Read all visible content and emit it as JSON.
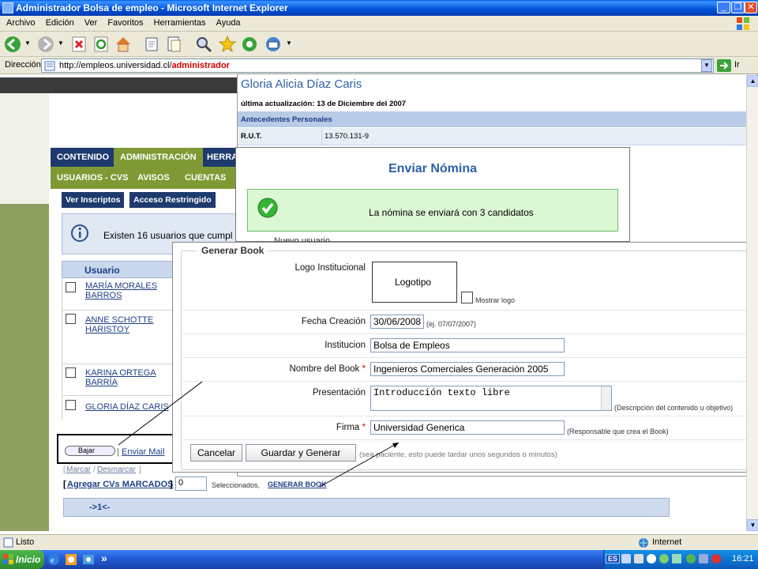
{
  "window": {
    "title": "Administrador Bolsa de empleo - Microsoft Internet Explorer"
  },
  "menu": [
    "Archivo",
    "Edición",
    "Ver",
    "Favoritos",
    "Herramientas",
    "Ayuda"
  ],
  "address": {
    "label": "Dirección",
    "url_prefix": "http://empleos.universidad.cl/",
    "url_highlight": "administrador",
    "go": "Ir"
  },
  "site": {
    "nav_main": [
      "CONTENIDO",
      "ADMINISTRACIÓN",
      "HERRA"
    ],
    "nav_sub": [
      "USUARIOS - CVS",
      "AVISOS",
      "CUENTAS"
    ],
    "buttons": [
      "Ver Inscriptos",
      "Acceso Restringido"
    ],
    "info_text": "Existen 16 usuarios que cumpl",
    "grid_header": "Usuario",
    "users": [
      "MARÍA MORALES BARROS",
      "ANNE SCHOTTE HARISTOY",
      "KARINA ORTEGA BARRÍA",
      "GLORIA DÍAZ CARIS"
    ],
    "action_bajar": "Bajar",
    "action_enviar": "Enviar Mail",
    "marcar": "Marcar",
    "desmarcar": "Desmarcar",
    "agregar": "Agregar CVs MARCADOS",
    "count_value": "0",
    "seleccionados": "Seleccionados,",
    "generar_book": "GENERAR BOOK",
    "pager": "->1<-"
  },
  "profile": {
    "name": "Gloria Alicia Díaz Caris",
    "updated": "última actualización: 13 de Diciembre del 2007",
    "section": "Antecedentes Personales",
    "rut_label": "R.U.T.",
    "rut_value": "13.570.131-9"
  },
  "nomina": {
    "title": "Enviar Nómina",
    "message": "La nómina se enviará con 3 candidatos",
    "partial": "Nuevo usuario"
  },
  "book": {
    "legend": "Generar Book",
    "logo_label": "Logo Institucional",
    "logo_placeholder": "Logotipo",
    "mostrar_logo": "Mostrar logo",
    "fecha_label": "Fecha Creación",
    "fecha_value": "30/06/2008",
    "fecha_hint": "(ej. 07/07/2007)",
    "institucion_label": "Institucion",
    "institucion_value": "Bolsa de Empleos",
    "nombre_label": "Nombre del Book",
    "nombre_value": "Ingenieros Comerciales Generación 2005",
    "presentacion_label": "Presentación",
    "presentacion_value": "Introducción texto libre",
    "presentacion_hint": "(Descripción del contenido u objetivo)",
    "firma_label": "Firma",
    "firma_value": "Universidad Generica",
    "firma_hint": "(Responsable que crea el Book)",
    "required": "*",
    "cancel": "Cancelar",
    "submit": "Guardar y Generar",
    "wait_hint": "(sea paciente, esto puede tardar unos segundos o minutos)"
  },
  "status": {
    "left": "Listo",
    "zone": "Internet"
  },
  "taskbar": {
    "start": "Inicio",
    "chevron": "»",
    "lang": "ES",
    "time": "16:21"
  },
  "colors": {
    "xp_blue": "#245edb",
    "nav_blue": "#1e3a6e",
    "nav_green": "#7f9a34",
    "success_bg": "#dcf7d4",
    "url_red": "#cc0000"
  }
}
